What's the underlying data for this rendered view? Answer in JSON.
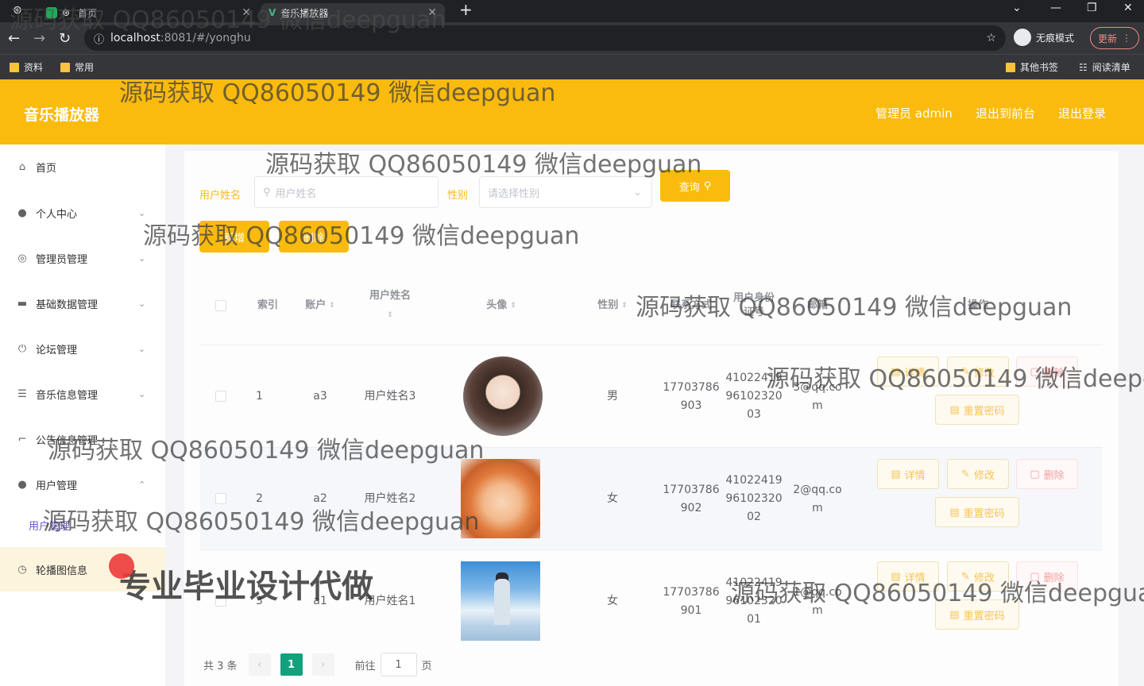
{
  "browser": {
    "tabs": [
      {
        "label": "首页"
      },
      {
        "label": "音乐播放器"
      }
    ],
    "new_tab": "+",
    "url_host": "localhost",
    "url_rest": ":8081/#/yonghu",
    "incognito": "无痕模式",
    "update": "更新",
    "bookmarks": [
      "资料",
      "常用"
    ],
    "bookmarks_right": [
      "其他书签",
      "阅读清单"
    ]
  },
  "header": {
    "title": "音乐播放器",
    "links": [
      "管理员 admin",
      "退出到前台",
      "退出登录"
    ],
    "bg_color": "#fbbb0e"
  },
  "sidebar": {
    "items": [
      {
        "label": "首页",
        "icon": "home-icon"
      },
      {
        "label": "个人中心",
        "icon": "user-icon"
      },
      {
        "label": "管理员管理",
        "icon": "compass-icon"
      },
      {
        "label": "基础数据管理",
        "icon": "monitor-icon"
      },
      {
        "label": "论坛管理",
        "icon": "power-icon"
      },
      {
        "label": "音乐信息管理",
        "icon": "list-icon"
      },
      {
        "label": "公告信息管理",
        "icon": "crop-icon"
      },
      {
        "label": "用户管理",
        "icon": "user-icon"
      },
      {
        "label": "轮播图信息",
        "icon": "clock-icon"
      }
    ],
    "sub_item": "用户管理"
  },
  "search": {
    "name_label": "用户姓名",
    "name_placeholder": "用户姓名",
    "gender_label": "性别",
    "gender_placeholder": "请选择性别",
    "query_button": "查询"
  },
  "actions": {
    "add": "新增",
    "delete": "删除"
  },
  "table": {
    "headers": {
      "index": "索引",
      "account": "账户",
      "name": "用户姓名",
      "avatar": "头像",
      "gender": "性别",
      "phone": "联系方式",
      "idcard": "用户身份证号",
      "email": "邮箱",
      "ops": "操作"
    },
    "rows": [
      {
        "index": "1",
        "account": "a3",
        "name": "用户姓名3",
        "gender": "男",
        "phone": [
          "17703786",
          "903"
        ],
        "idcard": [
          "41022419",
          "96102320",
          "03"
        ],
        "email": [
          "3@qq.co",
          "m"
        ]
      },
      {
        "index": "2",
        "account": "a2",
        "name": "用户姓名2",
        "gender": "女",
        "phone": [
          "17703786",
          "902"
        ],
        "idcard": [
          "41022419",
          "96102320",
          "02"
        ],
        "email": [
          "2@qq.co",
          "m"
        ]
      },
      {
        "index": "3",
        "account": "a1",
        "name": "用户姓名1",
        "gender": "女",
        "phone": [
          "17703786",
          "901"
        ],
        "idcard": [
          "41022419",
          "96102320",
          "01"
        ],
        "email": [
          "1@qq.co",
          "m"
        ]
      }
    ],
    "row_buttons": {
      "detail": "详情",
      "edit": "修改",
      "delete": "删除",
      "reset": "重置密码"
    }
  },
  "pager": {
    "total": "共 3 条",
    "current": "1",
    "goto_label": "前往",
    "goto_value": "1",
    "page_suffix": "页"
  },
  "watermarks": {
    "qq": "源码获取 QQ86050149 微信deepguan",
    "promo": "专业毕业设计代做"
  }
}
